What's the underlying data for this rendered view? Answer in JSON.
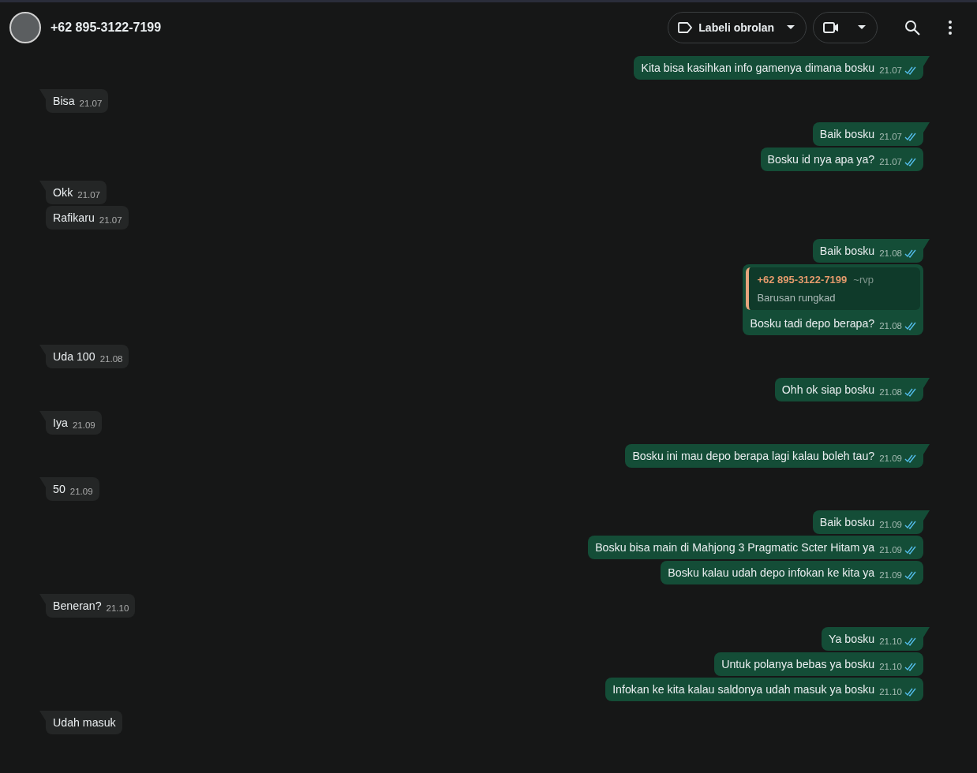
{
  "header": {
    "contact_name": "+62 895-3122-7199",
    "label_button": "Labeli obrolan"
  },
  "messages": [
    {
      "kind": "sent",
      "text": "Kita bisa kasihkan info gamenya dimana bosku",
      "time": "21.07",
      "read": true
    },
    {
      "kind": "received",
      "text": "Bisa",
      "time": "21.07"
    },
    {
      "kind": "sent",
      "text": "Baik bosku",
      "time": "21.07",
      "read": true
    },
    {
      "kind": "sent",
      "text": "Bosku id nya apa ya?",
      "time": "21.07",
      "read": true
    },
    {
      "kind": "received",
      "text": "Okk",
      "time": "21.07"
    },
    {
      "kind": "received",
      "text": "Rafikaru",
      "time": "21.07"
    },
    {
      "kind": "sent",
      "text": "Baik bosku",
      "time": "21.08",
      "read": true
    },
    {
      "kind": "sent",
      "text": "Bosku tadi depo berapa?",
      "time": "21.08",
      "read": true,
      "quote": {
        "author": "+62 895-3122-7199",
        "alias": "~rvp",
        "text": "Barusan rungkad"
      }
    },
    {
      "kind": "received",
      "text": "Uda 100",
      "time": "21.08"
    },
    {
      "kind": "sent",
      "text": "Ohh ok siap bosku",
      "time": "21.08",
      "read": true
    },
    {
      "kind": "received",
      "text": "Iya",
      "time": "21.09"
    },
    {
      "kind": "sent",
      "text": "Bosku ini mau depo berapa lagi kalau boleh tau?",
      "time": "21.09",
      "read": true
    },
    {
      "kind": "received",
      "text": "50",
      "time": "21.09"
    },
    {
      "kind": "sent",
      "text": "Baik bosku",
      "time": "21.09",
      "read": true
    },
    {
      "kind": "sent",
      "text": "Bosku bisa main di Mahjong 3 Pragmatic Scter Hitam ya",
      "time": "21.09",
      "read": true
    },
    {
      "kind": "sent",
      "text": "Bosku kalau udah depo infokan ke kita ya",
      "time": "21.09",
      "read": true
    },
    {
      "kind": "received",
      "text": "Beneran?",
      "time": "21.10"
    },
    {
      "kind": "sent",
      "text": "Ya bosku",
      "time": "21.10",
      "read": true
    },
    {
      "kind": "sent",
      "text": "Untuk polanya bebas ya bosku",
      "time": "21.10",
      "read": true
    },
    {
      "kind": "sent",
      "text": "Infokan ke kita kalau saldonya udah masuk ya bosku",
      "time": "21.10",
      "read": true
    },
    {
      "kind": "received",
      "text": "Udah masuk"
    }
  ]
}
